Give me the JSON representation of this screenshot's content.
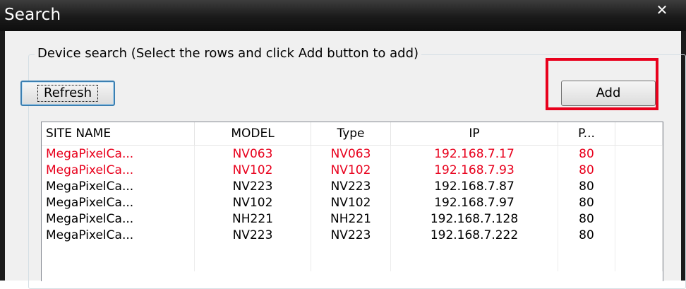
{
  "window": {
    "title": "Search",
    "close_glyph": "✕"
  },
  "group": {
    "label": "Device search (Select the rows and click Add button to add)"
  },
  "buttons": {
    "refresh": "Refresh",
    "add": "Add"
  },
  "table": {
    "headers": [
      "SITE NAME",
      "MODEL",
      "Type",
      "IP",
      "P..."
    ],
    "rows": [
      {
        "site": "MegaPixelCa...",
        "model": "NV063",
        "type": "NV063",
        "ip": "192.168.7.17",
        "port": "80",
        "highlight": true
      },
      {
        "site": "MegaPixelCa...",
        "model": "NV102",
        "type": "NV102",
        "ip": "192.168.7.93",
        "port": "80",
        "highlight": true
      },
      {
        "site": "MegaPixelCa...",
        "model": "NV223",
        "type": "NV223",
        "ip": "192.168.7.87",
        "port": "80",
        "highlight": false
      },
      {
        "site": "MegaPixelCa...",
        "model": "NV102",
        "type": "NV102",
        "ip": "192.168.7.97",
        "port": "80",
        "highlight": false
      },
      {
        "site": "MegaPixelCa...",
        "model": "NH221",
        "type": "NH221",
        "ip": "192.168.7.128",
        "port": "80",
        "highlight": false
      },
      {
        "site": "MegaPixelCa...",
        "model": "NV223",
        "type": "NV223",
        "ip": "192.168.7.222",
        "port": "80",
        "highlight": false
      }
    ]
  },
  "colors": {
    "highlight_text": "#e8001c",
    "annotation_box": "#e8001c"
  }
}
